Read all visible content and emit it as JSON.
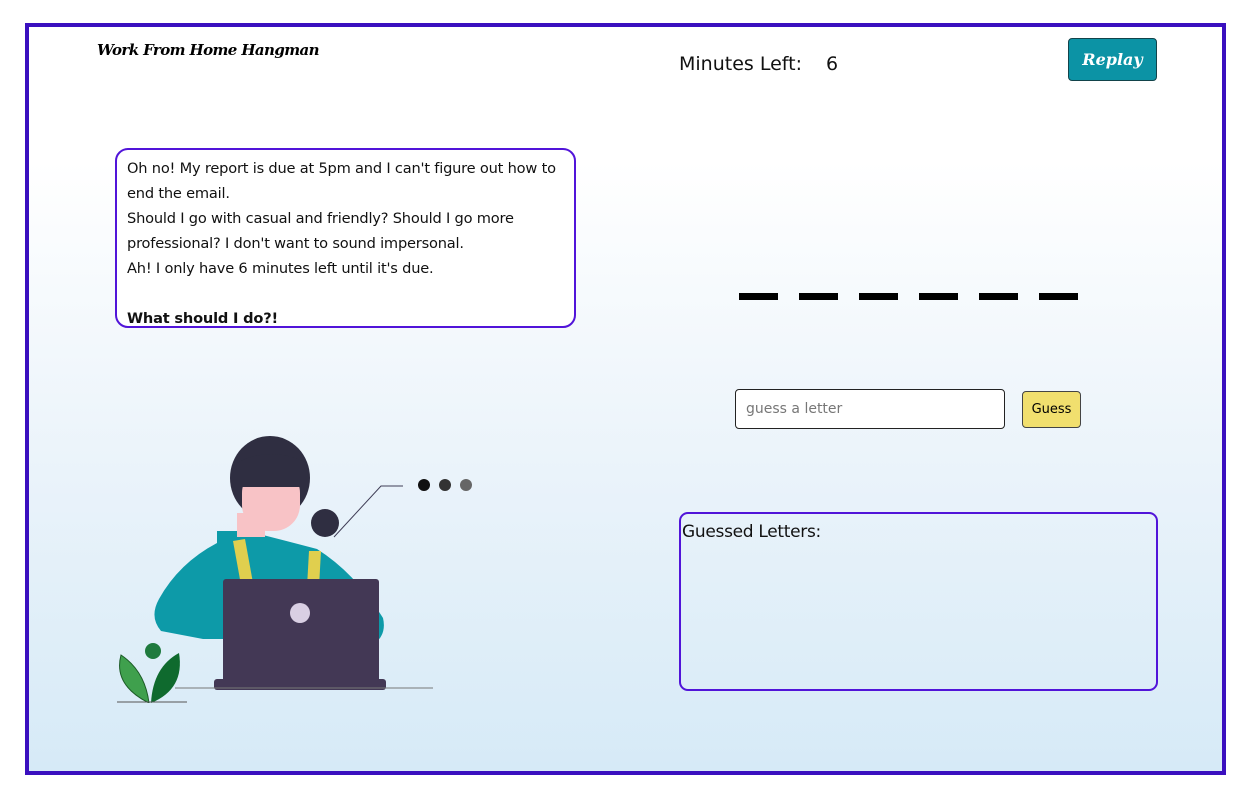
{
  "header": {
    "app_title": "Work From Home Hangman",
    "timer_label": "Minutes Left:",
    "timer_value": "6",
    "replay_label": "Replay"
  },
  "speech_bubble": {
    "lines": [
      "Oh no! My report is due at 5pm and I can't figure out how to end the email.",
      "Should I go with casual and friendly? Should I go more professional? I don't want to sound impersonal.",
      "Ah! I only have 6 minutes left until it's due."
    ],
    "question": "What should I do?!"
  },
  "puzzle": {
    "word_length": 6
  },
  "guess": {
    "placeholder": "guess a letter",
    "value": "",
    "button_label": "Guess"
  },
  "guessed_letters": {
    "label": "Guessed Letters:",
    "letters": []
  },
  "colors": {
    "frame_border": "#3a0fbf",
    "replay_bg": "#0c93a5",
    "guess_btn_bg": "#f1df6e",
    "box_border": "#5114d9"
  }
}
